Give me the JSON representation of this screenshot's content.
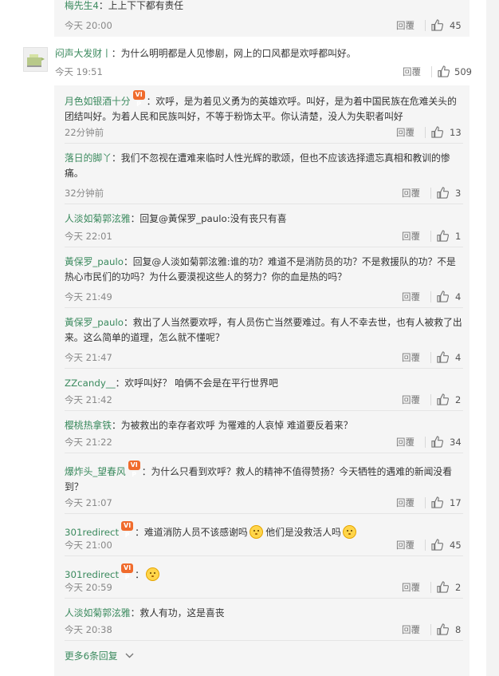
{
  "colors": {
    "name": "#3b8a5e",
    "text": "#333333",
    "meta": "#888888",
    "nested_bg": "#f5f5f5"
  },
  "top_reply": {
    "author": "梅先生4",
    "text": "：上上下下都有责任",
    "time": "今天 20:00",
    "reply_label": "回覆",
    "likes": "45"
  },
  "main_comment": {
    "avatar_icon": "default-avatar-icon",
    "author": "闷声大发财丨",
    "text": "：为什么明明都是人见惨剧，网上的口风都是欢呼都叫好。",
    "time": "今天 19:51",
    "reply_label": "回覆",
    "likes": "509"
  },
  "replies": [
    {
      "author": "月色如银酒十分",
      "badge": "VIP",
      "text": "：欢呼，是为着见义勇为的英雄欢呼。叫好，是为着中国民族在危难关头的团结叫好。为着人民和民族叫好，不等于粉饰太平。你认清楚，没人为失职者叫好",
      "time": "22分钟前",
      "reply_label": "回覆",
      "likes": "13"
    },
    {
      "author": "落日的脚丫",
      "text": "：我们不忽视在遭难来临时人性光辉的歌颂，但也不应该选择遗忘真相和教训的惨痛。",
      "time": "32分钟前",
      "reply_label": "回覆",
      "likes": "3"
    },
    {
      "author": "人淡如菊郭泫雅",
      "text": "：回复@黃保罗_paulo:没有丧只有喜",
      "time": "今天 22:01",
      "reply_label": "回覆",
      "likes": "1"
    },
    {
      "author": "黃保罗_paulo",
      "text": "：回复@人淡如菊郭泫雅:谁的功？难道不是消防员的功？不是救援队的功？不是热心市民们的功吗？为什么要漠视这些人的努力？你的血是热的吗？",
      "time": "今天 21:49",
      "reply_label": "回覆",
      "likes": "4"
    },
    {
      "author": "黃保罗_paulo",
      "text": "：救出了人当然要欢呼，有人员伤亡当然要难过。有人不幸去世，也有人被救了出来。这么简单的道理，怎么就不懂呢？",
      "time": "今天 21:47",
      "reply_label": "回覆",
      "likes": "4"
    },
    {
      "author": "ZZcandy__",
      "text": "：欢呼叫好？  咱俩不会是在平行世界吧",
      "time": "今天 21:42",
      "reply_label": "回覆",
      "likes": "2"
    },
    {
      "author": "樱桃热拿铁",
      "text": "：为被救出的幸存者欢呼 为罹难的人哀悼 难道要反着来？",
      "time": "今天 21:22",
      "reply_label": "回覆",
      "likes": "34"
    },
    {
      "author": "爆炸头_望春风",
      "badge": "VIP",
      "text": "：为什么只看到欢呼？救人的精神不值得赞扬？今天牺牲的遇难的新闻没看到？",
      "time": "今天 21:07",
      "reply_label": "回覆",
      "likes": "17"
    },
    {
      "author": "301redirect",
      "badge": "VIP",
      "text": "：难道消防人员不该感谢吗",
      "text_after_emoji": " 他们是没救活人吗",
      "emoji_count": 2,
      "time": "今天 21:00",
      "reply_label": "回覆",
      "likes": "45"
    },
    {
      "author": "301redirect",
      "badge": "VIP",
      "text": "：",
      "emoji_count": 1,
      "time": "今天 20:59",
      "reply_label": "回覆",
      "likes": "2"
    },
    {
      "author": "人淡如菊郭泫雅",
      "text": "：救人有功，这是喜丧",
      "time": "今天 20:38",
      "reply_label": "回覆",
      "likes": "8"
    }
  ],
  "more_replies": {
    "label": "更多6条回复",
    "icon": "chevron-down-icon"
  }
}
